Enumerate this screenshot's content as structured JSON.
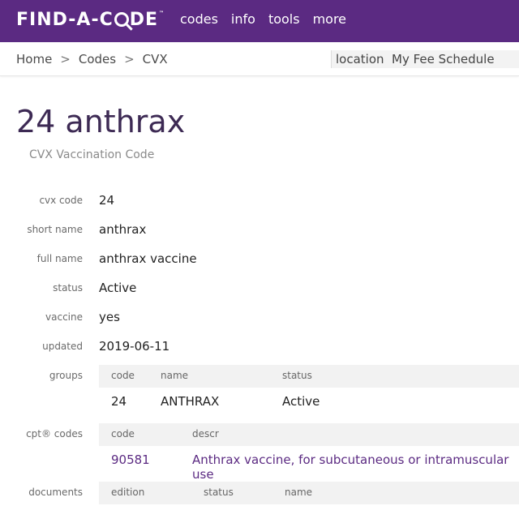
{
  "header": {
    "logo_text_a": "FIND-A-C",
    "logo_text_b": "DE",
    "logo_tm": "™",
    "nav": [
      "codes",
      "info",
      "tools",
      "more"
    ]
  },
  "breadcrumb": {
    "items": [
      "Home",
      "Codes",
      "CVX"
    ],
    "separator": ">"
  },
  "utility": {
    "location": "location",
    "fee_schedule": "My Fee Schedule"
  },
  "page": {
    "title": "24 anthrax",
    "subtitle": "CVX Vaccination Code"
  },
  "fields": [
    {
      "label": "cvx code",
      "value": "24"
    },
    {
      "label": "short name",
      "value": "anthrax"
    },
    {
      "label": "full name",
      "value": "anthrax vaccine"
    },
    {
      "label": "status",
      "value": "Active"
    },
    {
      "label": "vaccine",
      "value": "yes"
    },
    {
      "label": "updated",
      "value": "2019-06-11"
    }
  ],
  "groups": {
    "label": "groups",
    "columns": [
      "code",
      "name",
      "status"
    ],
    "rows": [
      [
        "24",
        "ANTHRAX",
        "Active"
      ]
    ]
  },
  "cpt_codes": {
    "label": "cpt® codes",
    "columns": [
      "code",
      "descr"
    ],
    "rows": [
      [
        "90581",
        "Anthrax vaccine, for subcutaneous or intramuscular use"
      ]
    ]
  },
  "documents": {
    "label": "documents",
    "columns": [
      "edition",
      "status",
      "name"
    ]
  },
  "colors": {
    "brand": "#5b2a82",
    "title": "#3d2a54"
  }
}
